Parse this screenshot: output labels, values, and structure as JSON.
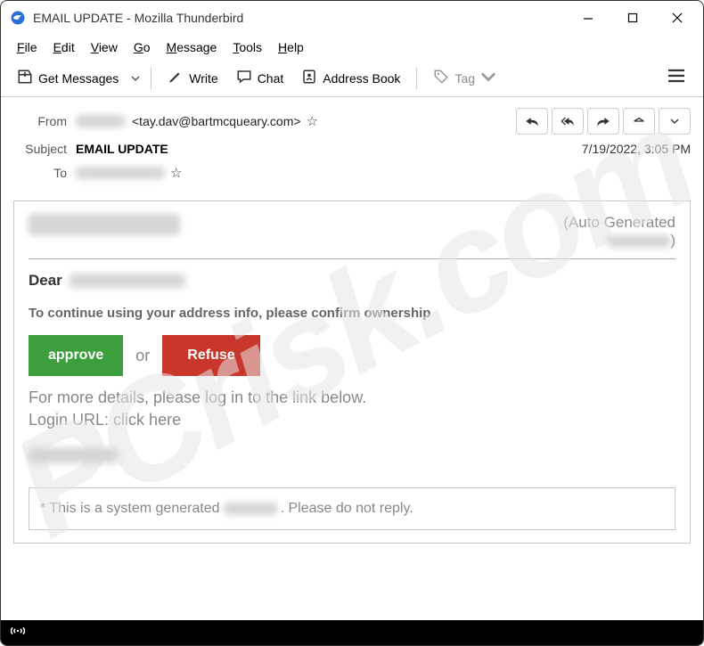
{
  "window": {
    "title": "EMAIL UPDATE - Mozilla Thunderbird"
  },
  "menu": {
    "file": "File",
    "edit": "Edit",
    "view": "View",
    "go": "Go",
    "message": "Message",
    "tools": "Tools",
    "help": "Help"
  },
  "toolbar": {
    "get_messages": "Get Messages",
    "write": "Write",
    "chat": "Chat",
    "address_book": "Address Book",
    "tag": "Tag"
  },
  "header": {
    "from_label": "From",
    "from_address": "<tay.dav@bartmcqueary.com>",
    "subject_label": "Subject",
    "subject_value": "EMAIL UPDATE",
    "to_label": "To",
    "date": "7/19/2022, 3:05 PM"
  },
  "body": {
    "auto_generated": "(Auto Generated",
    "auto_generated_close": ")",
    "dear": "Dear",
    "continue_text": "To continue using your address info, please confirm ownership",
    "approve": "approve",
    "or": "or",
    "refuse": "Refuse",
    "details_line1": "For more details, please log in to the link below.",
    "details_line2": "Login URL: click here",
    "footer_prefix": "* This is a system generated",
    "footer_suffix": ". Please do not reply."
  },
  "watermark": "PCrisk.com"
}
